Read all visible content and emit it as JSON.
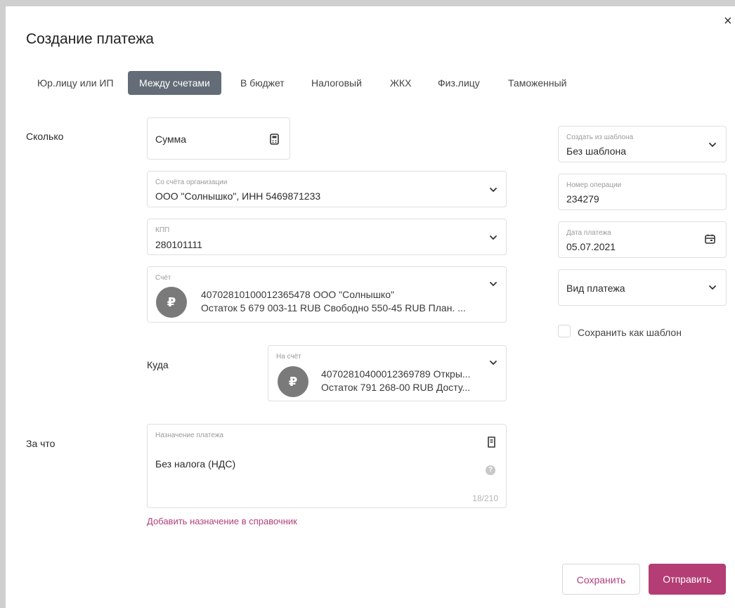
{
  "modal": {
    "title": "Создание платежа",
    "close": "×"
  },
  "tabs": [
    {
      "label": "Юр.лицу или ИП"
    },
    {
      "label": "Между счетами"
    },
    {
      "label": "В бюджет"
    },
    {
      "label": "Налоговый"
    },
    {
      "label": "ЖКХ"
    },
    {
      "label": "Физ.лицу"
    },
    {
      "label": "Таможенный"
    }
  ],
  "active_tab": "Между счетами",
  "sections": {
    "how_much": "Сколько",
    "where": "Куда",
    "for_what": "За что"
  },
  "amount": {
    "placeholder": "Сумма",
    "icon": "calculator-icon"
  },
  "from_account": {
    "label": "Со счёта организации",
    "value": "ООО \"Солнышко\", ИНН 5469871233"
  },
  "kpp": {
    "label": "КПП",
    "value": "280101111"
  },
  "account": {
    "label": "Счёт",
    "currency_symbol": "₽",
    "line1": "40702810100012365478 ООО \"Солнышко\"",
    "line2": "Остаток 5 679 003-11 RUB Свободно 550-45 RUB  План. ..."
  },
  "to_account": {
    "label": "На счёт",
    "currency_symbol": "₽",
    "line1": "40702810400012369789 Откры...",
    "line2": "Остаток 791 268-00 RUB Досту..."
  },
  "purpose": {
    "label": "Назначение платежа",
    "value": "Без налога (НДС)",
    "counter": "18/210",
    "help": "?"
  },
  "add_purpose_link": "Добавить назначение в справочник",
  "template": {
    "label": "Создать из шаблона",
    "value": "Без шаблона"
  },
  "operation_number": {
    "label": "Номер операции",
    "value": "234279"
  },
  "payment_date": {
    "label": "Дата платежа",
    "value": "05.07.2021",
    "icon": "calendar-icon"
  },
  "payment_type": {
    "placeholder": "Вид платежа"
  },
  "save_as_template": {
    "label": "Сохранить как шаблон",
    "checked": false
  },
  "buttons": {
    "save": "Сохранить",
    "send": "Отправить"
  },
  "colors": {
    "accent": "#b33d74",
    "tab_active_bg": "#636c77",
    "link": "#b0407a"
  }
}
